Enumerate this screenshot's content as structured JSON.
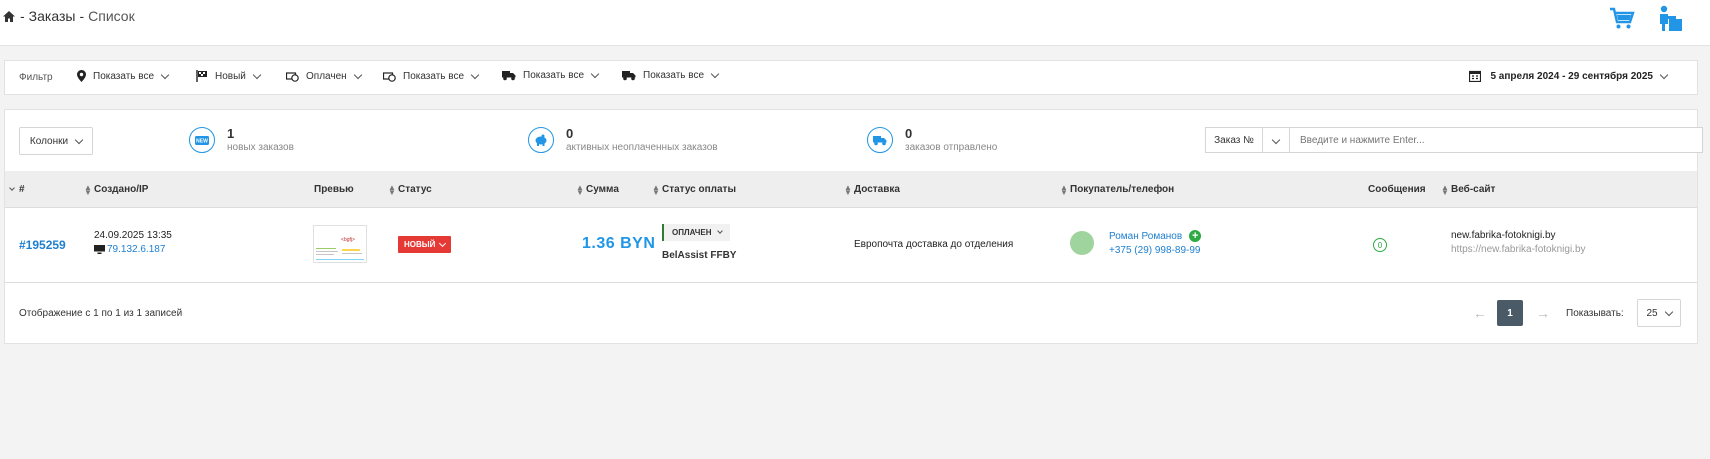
{
  "breadcrumb": {
    "section": "Заказы",
    "page": "Список",
    "sep": "-"
  },
  "filter": {
    "label": "Фильтр",
    "items": [
      {
        "icon": "map-pin-icon",
        "label": "Показать все"
      },
      {
        "icon": "flag-icon",
        "label": "Новый"
      },
      {
        "icon": "money-icon",
        "label": "Оплачен"
      },
      {
        "icon": "money-icon",
        "label": "Показать все"
      },
      {
        "icon": "truck-icon",
        "label": "Показать все"
      },
      {
        "icon": "truck-icon",
        "label": "Показать все"
      }
    ],
    "date_range": "5 апреля 2024 - 29 сентября 2025"
  },
  "toolbar": {
    "columns_label": "Колонки"
  },
  "stats": [
    {
      "icon": "new-badge-icon",
      "count": "1",
      "label": "новых заказов"
    },
    {
      "icon": "piggy-bank-icon",
      "count": "0",
      "label": "активных неоплаченных заказов"
    },
    {
      "icon": "truck-icon",
      "count": "0",
      "label": "заказов отправлено"
    }
  ],
  "search": {
    "field_label": "Заказ №",
    "placeholder": "Введите и нажмите Enter..."
  },
  "table": {
    "headers": {
      "id": "#",
      "created": "Создано/IP",
      "preview": "Превью",
      "status": "Статус",
      "amount": "Сумма",
      "payment_status": "Статус оплаты",
      "delivery": "Доставка",
      "buyer": "Покупатель/телефон",
      "messages": "Сообщения",
      "website": "Веб-сайт"
    },
    "rows": [
      {
        "order_id": "#195259",
        "created": "24.09.2025 13:35",
        "ip": "79.132.6.187",
        "status": "НОВЫЙ",
        "amount": "1.36 BYN",
        "payment_status": "ОПЛАЧЕН",
        "payment_method": "BelAssist FFBY",
        "delivery": "Европочта доставка до отделения",
        "buyer_name": "Роман Романов",
        "buyer_phone": "+375 (29) 998-89-99",
        "messages": "0",
        "site_name": "new.fabrika-fotoknigi.by",
        "site_url": "https://new.fabrika-fotoknigi.by"
      }
    ]
  },
  "footer": {
    "summary": "Отображение с 1 по 1 из 1 записей",
    "prev": "←",
    "current_page": "1",
    "next": "→",
    "per_page_label": "Показывать:",
    "per_page": "25"
  },
  "colors": {
    "accent": "#2196e6",
    "status_new": "#e53935",
    "paid": "#2e7d32",
    "pager": "#4a5a67"
  }
}
